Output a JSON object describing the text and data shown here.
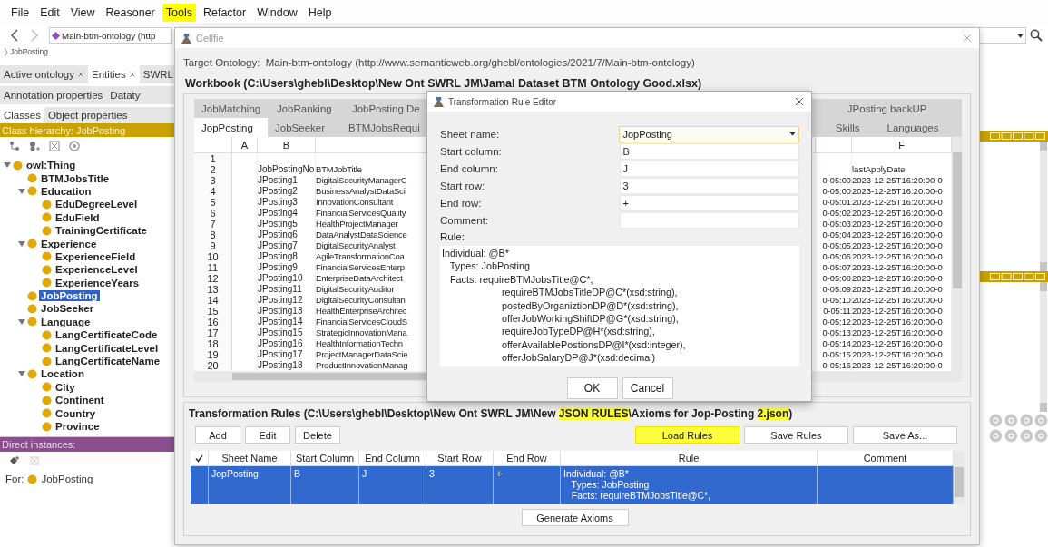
{
  "menu": [
    {
      "label": "File",
      "highlighted": false
    },
    {
      "label": "Edit",
      "highlighted": false
    },
    {
      "label": "View",
      "highlighted": false
    },
    {
      "label": "Reasoner",
      "highlighted": false
    },
    {
      "label": "Tools",
      "highlighted": true
    },
    {
      "label": "Refactor",
      "highlighted": false
    },
    {
      "label": "Window",
      "highlighted": false
    },
    {
      "label": "Help",
      "highlighted": false
    }
  ],
  "toolbar": {
    "ontology": "Main-btm-ontology (http",
    "breadcrumb": "JobPosting"
  },
  "main_tabs": [
    {
      "label": "Active ontology",
      "selected": false,
      "closable": true
    },
    {
      "label": "Entities",
      "selected": true,
      "closable": true
    },
    {
      "label": "SWRL",
      "selected": false,
      "closable": false
    }
  ],
  "entity_tabs": [
    {
      "label": "Annotation properties",
      "selected": false
    },
    {
      "label": "Dataty",
      "selected": false
    }
  ],
  "class_tabs": [
    {
      "label": "Classes",
      "selected": true
    },
    {
      "label": "Object properties",
      "selected": false
    }
  ],
  "hierarchy": {
    "title": "Class hierarchy: JobPosting",
    "tree": [
      {
        "label": "owl:Thing",
        "selected": false,
        "expanded": true,
        "children": [
          {
            "label": "BTMJobsTitle",
            "selected": false
          },
          {
            "label": "Education",
            "selected": false,
            "expanded": true,
            "children": [
              {
                "label": "EduDegreeLevel",
                "selected": false
              },
              {
                "label": "EduField",
                "selected": false
              },
              {
                "label": "TrainingCertificate",
                "selected": false
              }
            ]
          },
          {
            "label": "Experience",
            "selected": false,
            "expanded": true,
            "children": [
              {
                "label": "ExperienceField",
                "selected": false
              },
              {
                "label": "ExperienceLevel",
                "selected": false
              },
              {
                "label": "ExperienceYears",
                "selected": false
              }
            ]
          },
          {
            "label": "JobPosting",
            "selected": true
          },
          {
            "label": "JobSeeker",
            "selected": false
          },
          {
            "label": "Language",
            "selected": false,
            "expanded": true,
            "children": [
              {
                "label": "LangCertificateCode",
                "selected": false
              },
              {
                "label": "LangCertificateLevel",
                "selected": false
              },
              {
                "label": "LangCertificateName",
                "selected": false
              }
            ]
          },
          {
            "label": "Location",
            "selected": false,
            "expanded": true,
            "children": [
              {
                "label": "City",
                "selected": false
              },
              {
                "label": "Continent",
                "selected": false
              },
              {
                "label": "Country",
                "selected": false
              },
              {
                "label": "Province",
                "selected": false
              }
            ]
          }
        ]
      }
    ]
  },
  "instances": {
    "title": "Direct instances:",
    "for_label": "For:",
    "for_value": "JobPosting"
  },
  "cellfie": {
    "title": "Cellfie",
    "target_label": "Target Ontology:",
    "target": "Main-btm-ontology (http://www.semanticweb.org/ghebl/ontologies/2021/7/Main-btm-ontology)",
    "workbook_title": "Workbook (C:\\Users\\ghebl\\Desktop\\New Ont SWRL JM\\Jamal Dataset BTM Ontology Good.xlsx)",
    "sheet_tabs_top_left": [
      {
        "label": "JobMatching",
        "selected": false
      },
      {
        "label": "JobRanking",
        "selected": false
      },
      {
        "label": "JobPosting De",
        "selected": false
      }
    ],
    "sheet_tabs_top_right": [
      {
        "label": "JPosting backUP",
        "selected": false
      }
    ],
    "sheet_tabs_bottom_left": [
      {
        "label": "JopPosting",
        "selected": true
      },
      {
        "label": "JobSeeker",
        "selected": false
      },
      {
        "label": "BTMJobsRequi",
        "selected": false
      }
    ],
    "sheet_tabs_bottom_right": [
      {
        "label": "Skills",
        "selected": false
      },
      {
        "label": "Languages",
        "selected": false
      }
    ],
    "grid": {
      "headers": {
        "column_a": "A",
        "column_b": "B",
        "column_f": "F"
      },
      "rows": [
        {
          "number": "1"
        },
        {
          "number": "2",
          "column_b": "JobPostingNo",
          "column_c": "BTMJobTitle",
          "column_f": "lastApplyDate"
        },
        {
          "number": "3",
          "column_b": "JPosting1",
          "column_c": "DigitalSecurityManagerC",
          "column_e": "0-05:00",
          "column_f": "2023-12-25T16:20:00-0"
        },
        {
          "number": "4",
          "column_b": "JPosting2",
          "column_c": "BusinessAnalystDataSci",
          "column_e": "0-05:00",
          "column_f": "2023-12-25T16:20:00-0"
        },
        {
          "number": "5",
          "column_b": "JPosting3",
          "column_c": "InnovationConsultant",
          "column_e": "0-05:01",
          "column_f": "2023-12-25T16:20:00-0"
        },
        {
          "number": "6",
          "column_b": "JPosting4",
          "column_c": "FinancialServicesQuality",
          "column_e": "0-05:02",
          "column_f": "2023-12-25T16:20:00-0"
        },
        {
          "number": "7",
          "column_b": "JPosting5",
          "column_c": "HealthProjectManager",
          "column_e": "0-05:03",
          "column_f": "2023-12-25T16:20:00-0"
        },
        {
          "number": "8",
          "column_b": "JPosting6",
          "column_c": "DataAnalystDataScience",
          "column_e": "0-05:04",
          "column_f": "2023-12-25T16:20:00-0"
        },
        {
          "number": "9",
          "column_b": "JPosting7",
          "column_c": "DigitalSecurityAnalyst",
          "column_e": "0-05:05",
          "column_f": "2023-12-25T16:20:00-0"
        },
        {
          "number": "10",
          "column_b": "JPosting8",
          "column_c": "AgileTransformationCoa",
          "column_e": "0-05:06",
          "column_f": "2023-12-25T16:20:00-0"
        },
        {
          "number": "11",
          "column_b": "JPosting9",
          "column_c": "FinancialServicesEnterp",
          "column_e": "0-05:07",
          "column_f": "2023-12-25T16:20:00-0"
        },
        {
          "number": "12",
          "column_b": "JPosting10",
          "column_c": "EnterpriseDataArchitect",
          "column_e": "0-05:08",
          "column_f": "2023-12-25T16:20:00-0"
        },
        {
          "number": "13",
          "column_b": "JPosting11",
          "column_c": "DigitalSecurityAuditor",
          "column_e": "0-05:09",
          "column_f": "2023-12-25T16:20:00-0"
        },
        {
          "number": "14",
          "column_b": "JPosting12",
          "column_c": "DigitalSecurityConsultan",
          "column_e": "0-05:10",
          "column_f": "2023-12-25T16:20:00-0"
        },
        {
          "number": "15",
          "column_b": "JPosting13",
          "column_c": "HealthEnterpriseArchitec",
          "column_e": "0-05:11",
          "column_f": "2023-12-25T16:20:00-0"
        },
        {
          "number": "16",
          "column_b": "JPosting14",
          "column_c": "FinancialServicesCloudS",
          "column_e": "0-05:12",
          "column_f": "2023-12-25T16:20:00-0"
        },
        {
          "number": "17",
          "column_b": "JPosting15",
          "column_c": "StrategicInnovationMana",
          "column_e": "0-05:13",
          "column_f": "2023-12-25T16:20:00-0"
        },
        {
          "number": "18",
          "column_b": "JPosting16",
          "column_c": "HealthInformationTechn",
          "column_e": "0-05:14",
          "column_f": "2023-12-25T16:20:00-0"
        },
        {
          "number": "19",
          "column_b": "JPosting17",
          "column_c": "ProjectManagerDataScie",
          "column_e": "0-05:15",
          "column_f": "2023-12-25T16:20:00-0"
        },
        {
          "number": "20",
          "column_b": "JPosting18",
          "column_c": "ProductInnovationManag",
          "column_e": "0-05:16",
          "column_f": "2023-12-25T16:20:00-0"
        }
      ]
    },
    "rules": {
      "title_segments": [
        {
          "text": "Transformation Rules (C:\\Users\\ghebl\\Desktop\\New Ont SWRL JM\\New ",
          "highlighted": false
        },
        {
          "text": "JSON RULES",
          "highlighted": true
        },
        {
          "text": "\\Axioms for Jop-Posting ",
          "highlighted": false
        },
        {
          "text": "2.json",
          "highlighted": true
        },
        {
          "text": ")",
          "highlighted": false
        }
      ],
      "buttons_left": [
        {
          "label": "Add",
          "highlighted": false
        },
        {
          "label": "Edit",
          "highlighted": false
        },
        {
          "label": "Delete",
          "highlighted": false
        }
      ],
      "buttons_right": [
        {
          "label": "Load Rules",
          "highlighted": true
        },
        {
          "label": "Save Rules",
          "highlighted": false
        },
        {
          "label": "Save As...",
          "highlighted": false
        }
      ],
      "columns": [
        "Sheet Name",
        "Start Column",
        "End Column",
        "Start Row",
        "End Row",
        "Rule",
        "Comment"
      ],
      "rows": [
        {
          "selected": true,
          "sheet_name": "JopPosting",
          "start_column": "B",
          "end_column": "J",
          "start_row": "3",
          "end_row": "+",
          "rule": "Individual: @B*\n   Types: JobPosting\n   Facts: requireBTMJobsTitle@C*,"
        }
      ],
      "generate_button": "Generate Axioms"
    }
  },
  "editor": {
    "title": "Transformation Rule Editor",
    "fields": [
      {
        "label": "Sheet name:",
        "kind": "dropdown",
        "value": "JopPosting"
      },
      {
        "label": "Start column:",
        "kind": "text",
        "value": "B"
      },
      {
        "label": "End column:",
        "kind": "text",
        "value": "J"
      },
      {
        "label": "Start row:",
        "kind": "text",
        "value": "3"
      },
      {
        "label": "End row:",
        "kind": "text",
        "value": "+"
      },
      {
        "label": "Comment:",
        "kind": "text"
      }
    ],
    "rule_label": "Rule:",
    "rule": "Individual: @B*\n   Types: JobPosting\n   Facts: requireBTMJobsTitle@C*,\n                      requireBTMJobsTitleDP@C*(xsd:string),\n                      postedByOrganiztionDP@D*(xsd:string),\n                      offerJobWorkingShiftDP@G*(xsd:string),\n                      requireJobTypeDP@H*(xsd:string),\n                      offerAvailablePostionsDP@I*(xsd:integer),\n                      offerJobSalaryDP@J*(xsd:decimal)",
    "buttons": [
      "OK",
      "Cancel"
    ]
  }
}
